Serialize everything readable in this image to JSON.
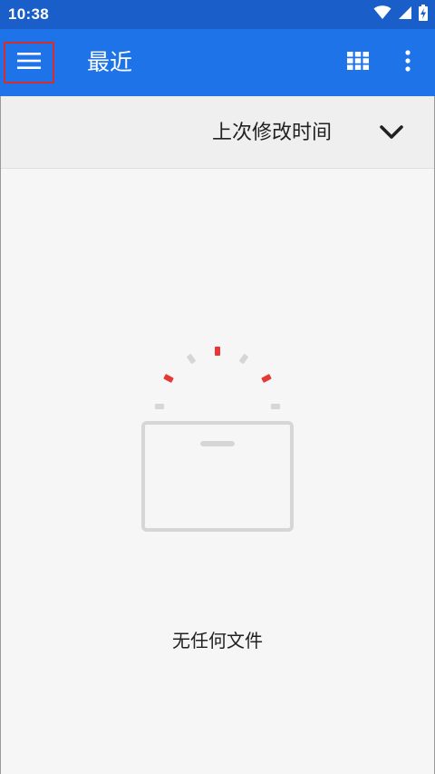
{
  "status_bar": {
    "time": "10:38",
    "icons": [
      "wifi-icon",
      "cellular-signal-icon",
      "battery-charging-icon"
    ]
  },
  "app_bar": {
    "title": "最近",
    "menu_icon": "menu-icon",
    "grid_icon": "grid-view-icon",
    "more_icon": "more-vert-icon"
  },
  "sort_bar": {
    "label": "上次修改时间",
    "icon": "chevron-down-icon"
  },
  "empty_state": {
    "message": "无任何文件",
    "icon": "empty-box-icon"
  },
  "colors": {
    "status_bar": "#1a5fc9",
    "app_bar": "#1e73e8",
    "accent_red": "#e53935",
    "illustration_gray": "#d6d6d6"
  }
}
